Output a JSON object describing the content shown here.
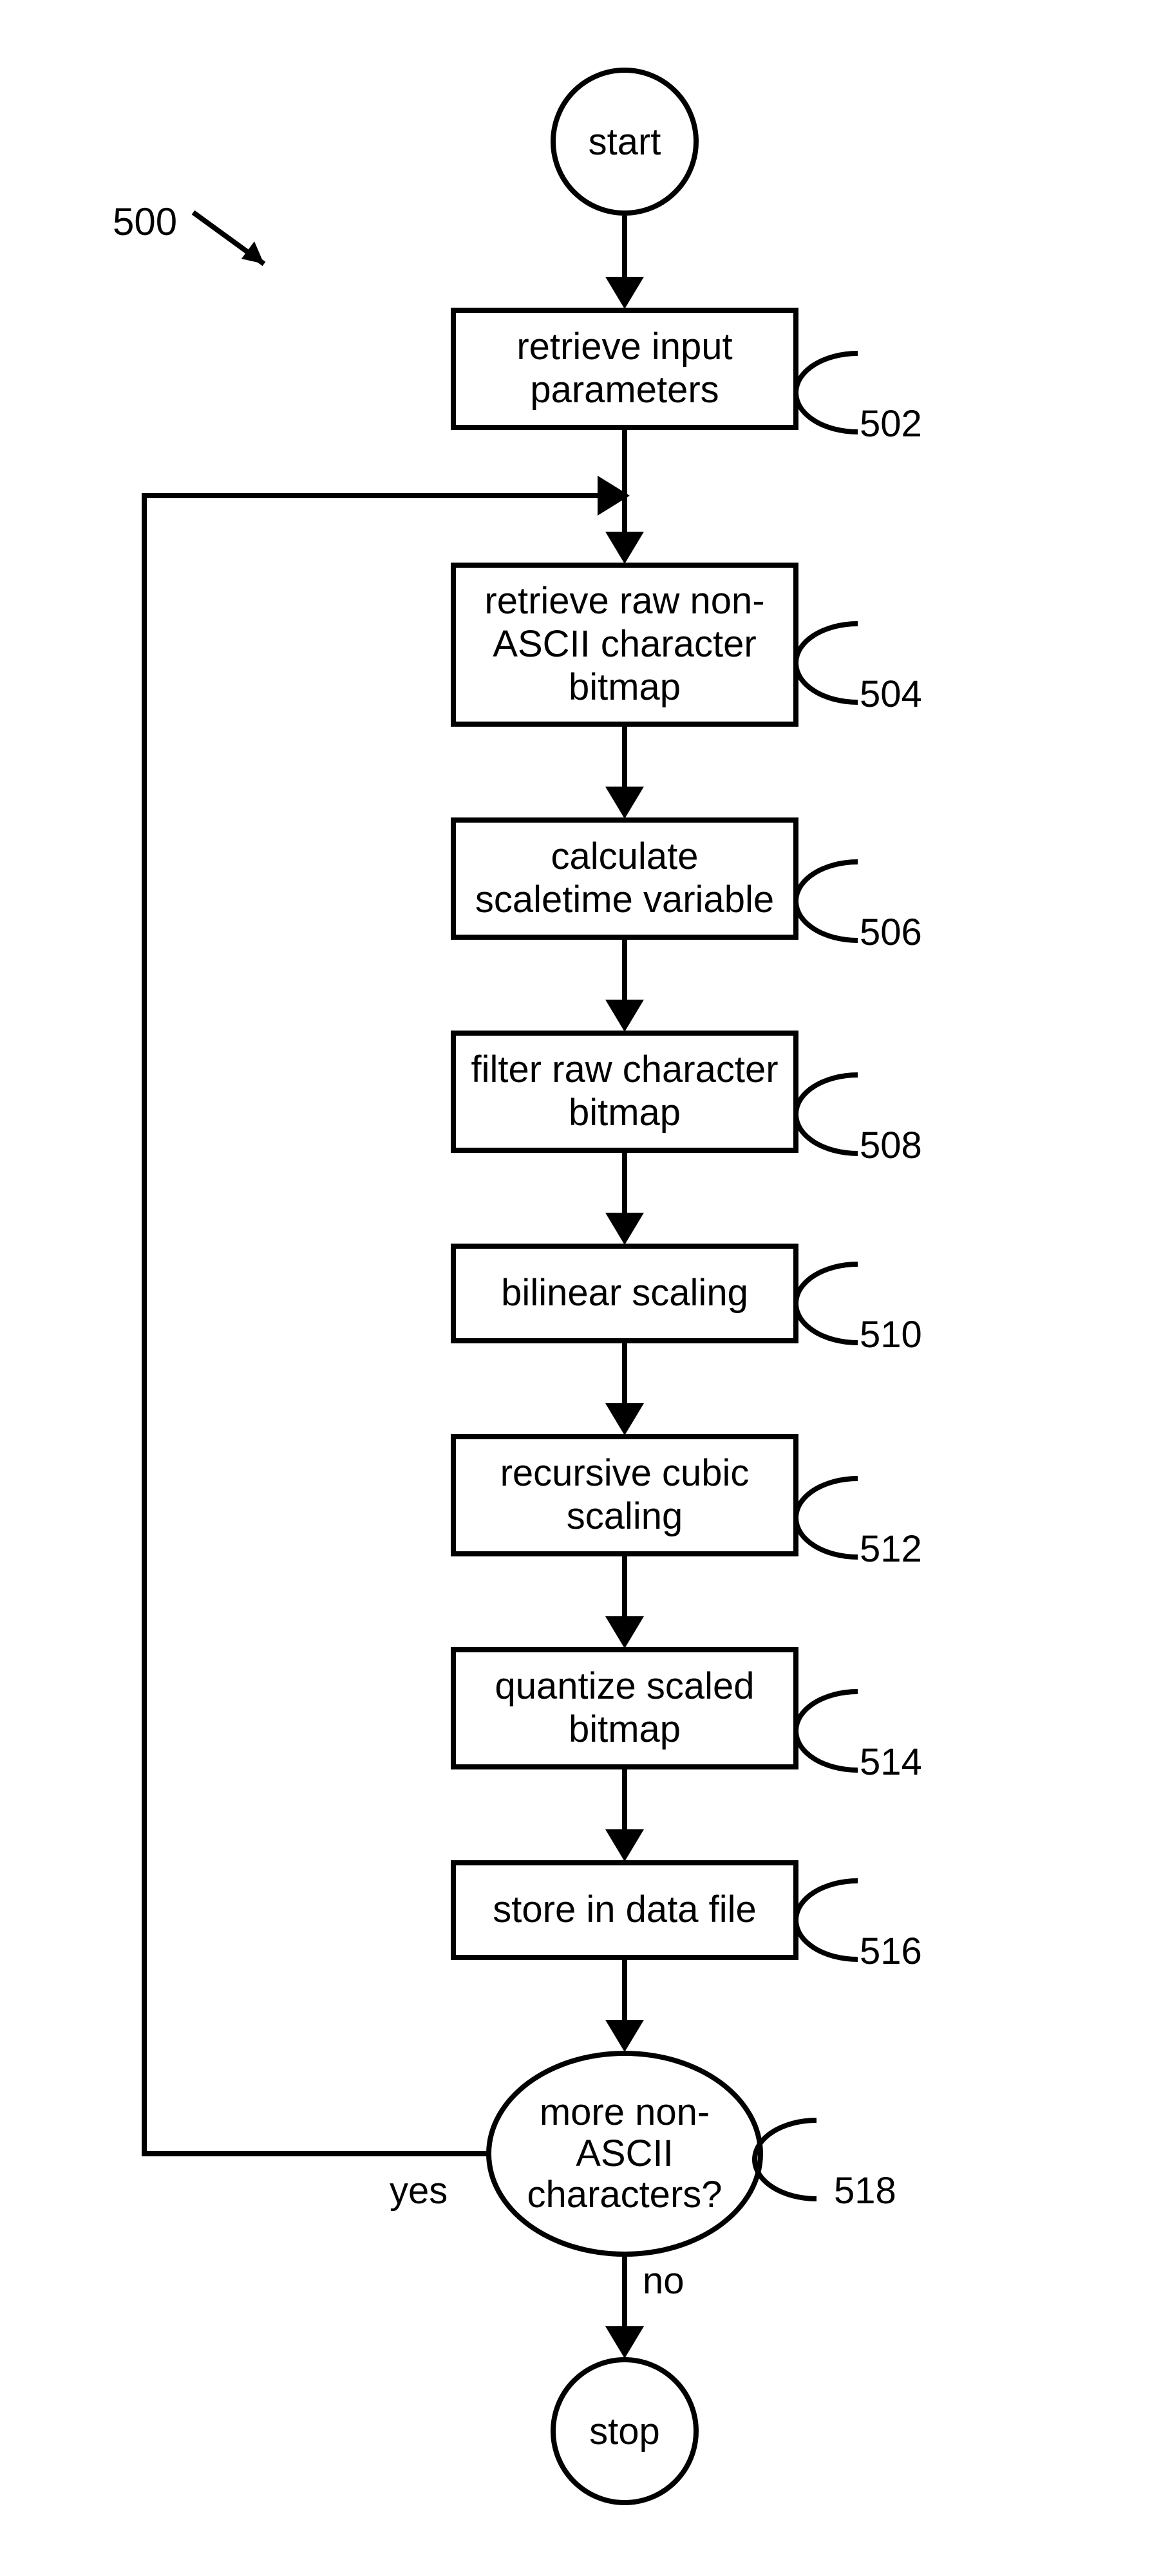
{
  "figure_ref": "500",
  "terminals": {
    "start": "start",
    "stop": "stop"
  },
  "steps": {
    "s502": {
      "text": "retrieve input\nparameters",
      "num": "502"
    },
    "s504": {
      "text": "retrieve raw non-\nASCII character\nbitmap",
      "num": "504"
    },
    "s506": {
      "text": "calculate\nscaletime variable",
      "num": "506"
    },
    "s508": {
      "text": "filter raw character\nbitmap",
      "num": "508"
    },
    "s510": {
      "text": "bilinear scaling",
      "num": "510"
    },
    "s512": {
      "text": "recursive cubic\nscaling",
      "num": "512"
    },
    "s514": {
      "text": "quantize scaled\nbitmap",
      "num": "514"
    },
    "s516": {
      "text": "store in data file",
      "num": "516"
    }
  },
  "decision": {
    "text": "more non-\nASCII\ncharacters?",
    "num": "518"
  },
  "edges": {
    "yes": "yes",
    "no": "no"
  }
}
